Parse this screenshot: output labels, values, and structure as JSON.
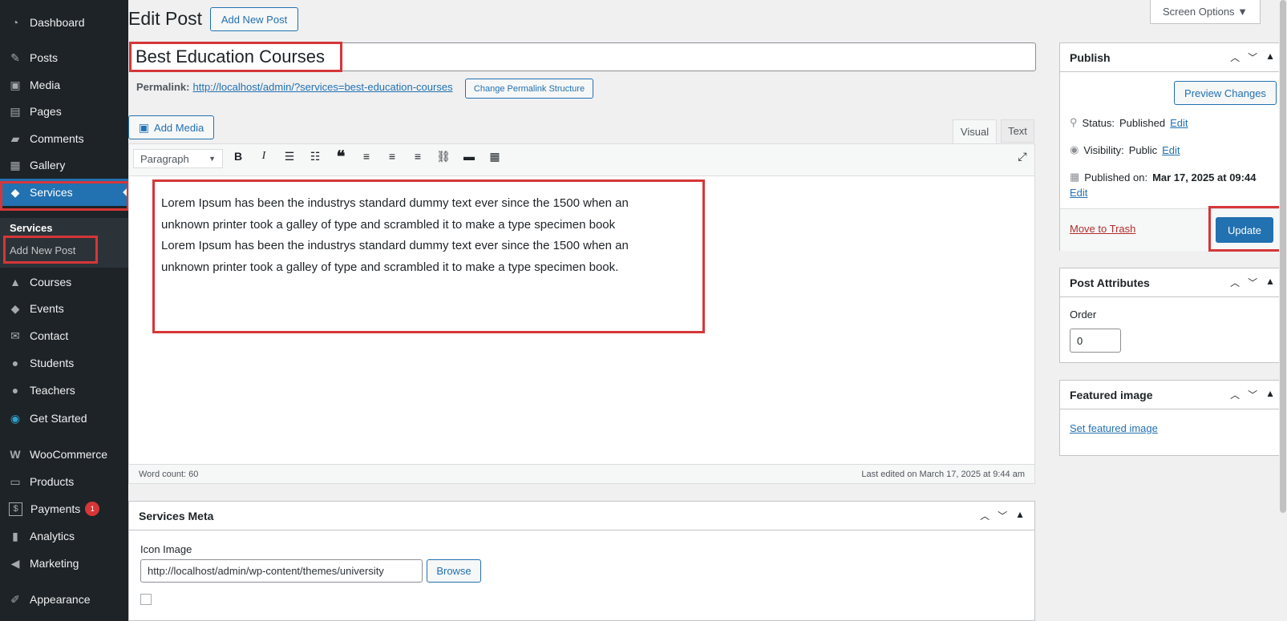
{
  "sidebar": {
    "items": [
      {
        "label": "Dashboard",
        "icon": "dashboard-icon",
        "glyph": "◔"
      },
      {
        "label": "Posts",
        "icon": "pin-icon",
        "glyph": "✎"
      },
      {
        "label": "Media",
        "icon": "media-icon",
        "glyph": "▣"
      },
      {
        "label": "Pages",
        "icon": "pages-icon",
        "glyph": "▤"
      },
      {
        "label": "Comments",
        "icon": "comments-icon",
        "glyph": "▰"
      },
      {
        "label": "Gallery",
        "icon": "gallery-icon",
        "glyph": "▦"
      },
      {
        "label": "Services",
        "icon": "tag-icon",
        "glyph": "◆"
      },
      {
        "label": "Courses",
        "icon": "graduation-cap-icon",
        "glyph": "▲"
      },
      {
        "label": "Events",
        "icon": "tag-icon",
        "glyph": "◆"
      },
      {
        "label": "Contact",
        "icon": "mail-icon",
        "glyph": "✉"
      },
      {
        "label": "Students",
        "icon": "user-icon",
        "glyph": "●"
      },
      {
        "label": "Teachers",
        "icon": "user-icon",
        "glyph": "●"
      },
      {
        "label": "Get Started",
        "icon": "globe-icon",
        "glyph": "◉"
      },
      {
        "label": "WooCommerce",
        "icon": "woocommerce-icon",
        "glyph": "W"
      },
      {
        "label": "Products",
        "icon": "archive-icon",
        "glyph": "▭"
      },
      {
        "label": "Payments",
        "icon": "dollar-icon",
        "glyph": "$",
        "badge": "1"
      },
      {
        "label": "Analytics",
        "icon": "bar-chart-icon",
        "glyph": "▮"
      },
      {
        "label": "Marketing",
        "icon": "megaphone-icon",
        "glyph": "◀"
      },
      {
        "label": "Appearance",
        "icon": "brush-icon",
        "glyph": "✐"
      }
    ],
    "submenu": {
      "title": "Services",
      "add_new": "Add New Post"
    }
  },
  "header": {
    "title": "Edit Post",
    "add_new": "Add New Post",
    "screen_options": "Screen Options ▼"
  },
  "post": {
    "title": "Best Education Courses",
    "permalink_label": "Permalink:",
    "permalink_url": "http://localhost/admin/?services=best-education-courses",
    "change_permalink": "Change Permalink Structure"
  },
  "editor": {
    "add_media": "Add Media",
    "tab_visual": "Visual",
    "tab_text": "Text",
    "format": "Paragraph",
    "content": "Lorem Ipsum has been the industrys standard dummy text ever since the 1500 when an unknown printer took a galley of type and scrambled it to make a type specimen book Lorem Ipsum has been the industrys standard dummy text ever since the 1500 when an unknown printer took a galley of type and scrambled it to make a type specimen book.",
    "word_count": "Word count: 60",
    "last_edited": "Last edited on March 17, 2025 at 9:44 am"
  },
  "publish": {
    "title": "Publish",
    "preview": "Preview Changes",
    "status_label": "Status:",
    "status_value": "Published",
    "visibility_label": "Visibility:",
    "visibility_value": "Public",
    "published_label": "Published on:",
    "published_value": "Mar 17, 2025 at 09:44",
    "edit": "Edit",
    "trash": "Move to Trash",
    "update": "Update"
  },
  "attributes": {
    "title": "Post Attributes",
    "order_label": "Order",
    "order_value": "0"
  },
  "featured": {
    "title": "Featured image",
    "set_link": "Set featured image"
  },
  "services_meta": {
    "title": "Services Meta",
    "icon_label": "Icon Image",
    "icon_value": "http://localhost/admin/wp-content/themes/university",
    "browse": "Browse"
  }
}
